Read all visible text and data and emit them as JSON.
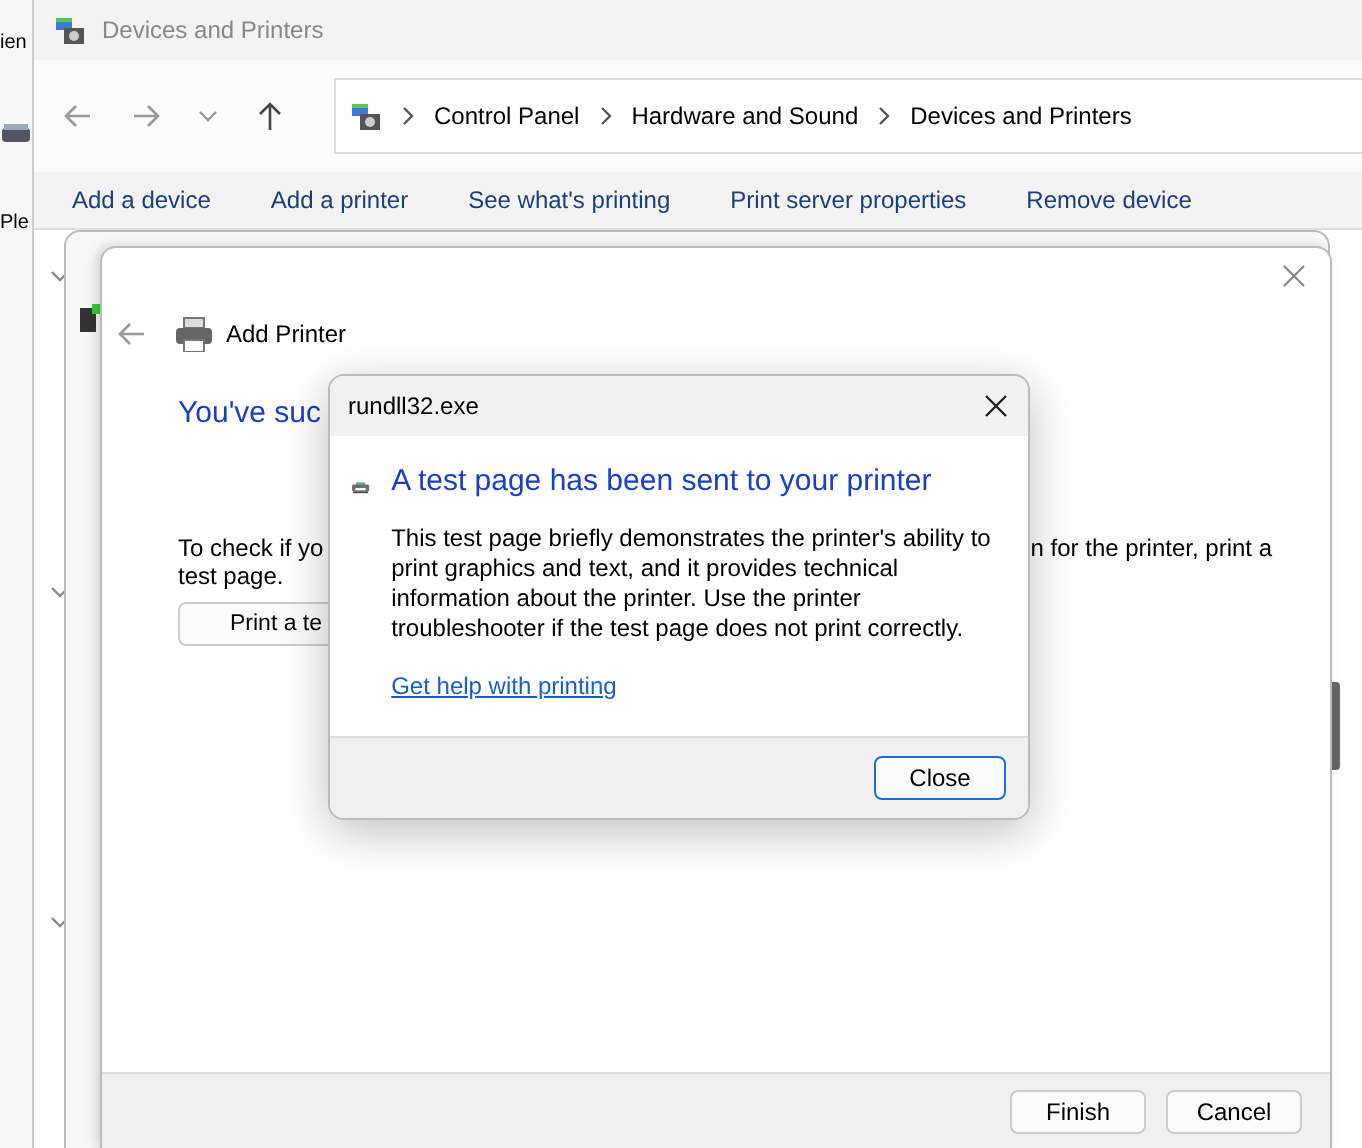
{
  "background_window": {
    "texts": [
      "ien",
      "Ple"
    ]
  },
  "window": {
    "title": "Devices and Printers",
    "breadcrumb": [
      "Control Panel",
      "Hardware and Sound",
      "Devices and Printers"
    ],
    "toolbar": [
      "Add a device",
      "Add a printer",
      "See what's printing",
      "Print server properties",
      "Remove device"
    ]
  },
  "wizard": {
    "title": "Add Printer",
    "heading": "You've suc",
    "instruction_left": "To check if yo",
    "instruction_right": "n for the printer, print a",
    "instruction_line2": "test page.",
    "test_button": "Print a te",
    "buttons": [
      {
        "label": "Finish",
        "default": false
      },
      {
        "label": "Cancel",
        "default": false
      }
    ]
  },
  "dialog": {
    "title": "rundll32.exe",
    "heading": "A test page has been sent to your printer",
    "body": "This test page briefly demonstrates the printer's ability to print graphics and text, and it provides technical information about the printer. Use the printer troubleshooter if the test page does not print correctly.",
    "link": "Get help with printing",
    "buttons": [
      {
        "label": "Close",
        "default": true
      }
    ]
  }
}
